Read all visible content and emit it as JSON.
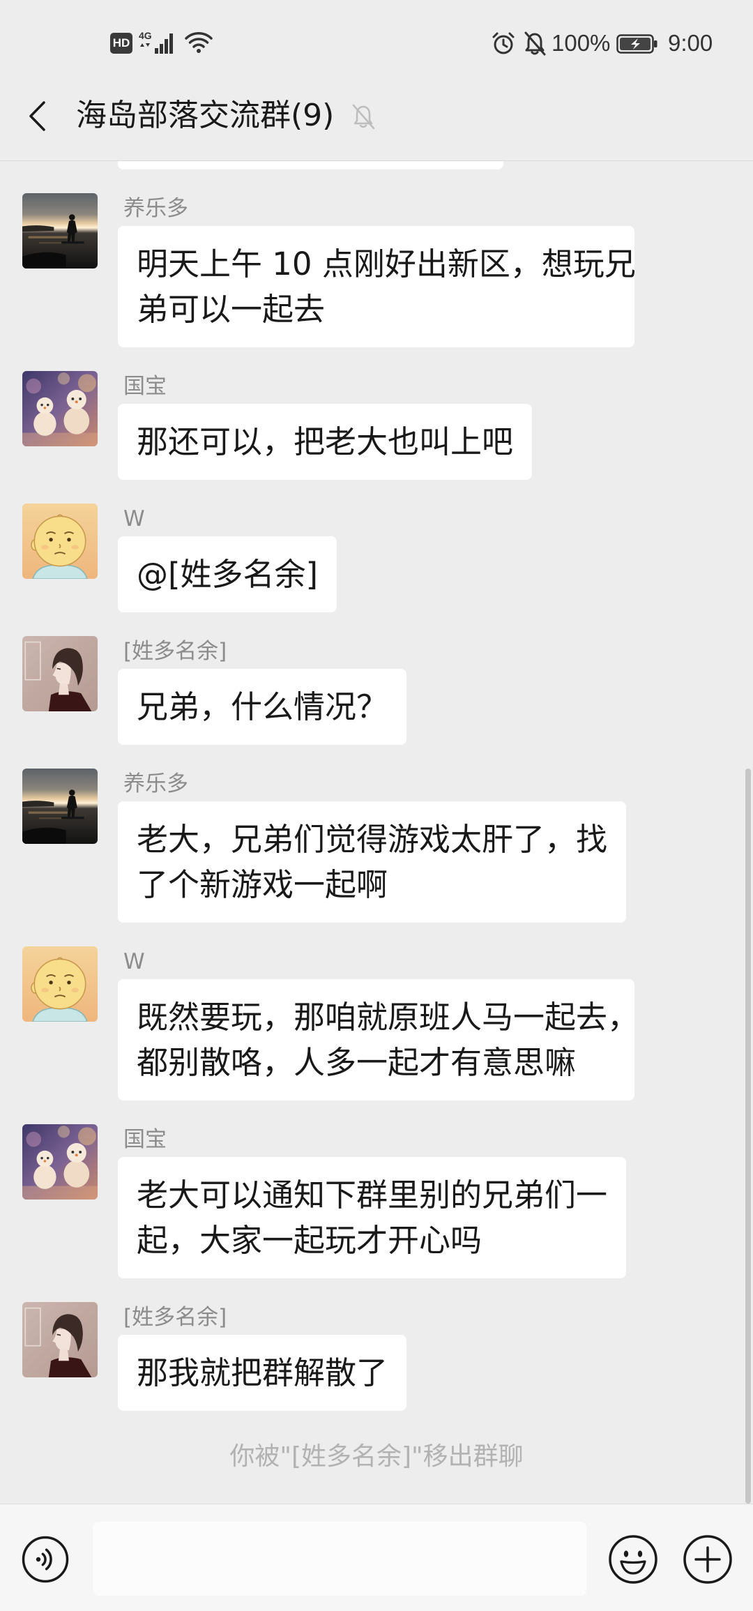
{
  "status_bar": {
    "hd_label": "HD",
    "network_label": "4G",
    "battery_percent": "100%",
    "battery_level": 1,
    "time": "9:00",
    "icons": {
      "hd": "hd-badge-icon",
      "signal": "cellular-signal-icon",
      "wifi": "wifi-icon",
      "alarm": "alarm-clock-icon",
      "silent": "bell-off-icon",
      "battery": "battery-charging-icon"
    }
  },
  "header": {
    "title": "海岛部落交流群(9)",
    "back_icon": "chevron-left-icon",
    "mute_icon": "bell-off-icon"
  },
  "messages": [
    {
      "sender": "养乐多",
      "avatar_icon": "sunset-silhouette-avatar",
      "lines": [
        "明天上午 10 点刚好出新区，想玩兄",
        "弟可以一起去"
      ]
    },
    {
      "sender": "国宝",
      "avatar_icon": "snowman-avatar",
      "lines": [
        "那还可以，把老大也叫上吧"
      ]
    },
    {
      "sender": "W",
      "avatar_icon": "cartoon-baby-avatar",
      "lines": [
        "@[姓多名余]"
      ]
    },
    {
      "sender": "[姓多名余]",
      "avatar_icon": "anime-profile-avatar",
      "lines": [
        "兄弟，什么情况？"
      ]
    },
    {
      "sender": "养乐多",
      "avatar_icon": "sunset-silhouette-avatar",
      "lines": [
        "老大，兄弟们觉得游戏太肝了，找",
        "了个新游戏一起啊"
      ]
    },
    {
      "sender": "W",
      "avatar_icon": "cartoon-baby-avatar",
      "lines": [
        "既然要玩，那咱就原班人马一起去，",
        "都别散咯，人多一起才有意思嘛"
      ]
    },
    {
      "sender": "国宝",
      "avatar_icon": "snowman-avatar",
      "lines": [
        "老大可以通知下群里别的兄弟们一",
        "起，大家一起玩才开心吗"
      ]
    },
    {
      "sender": "[姓多名余]",
      "avatar_icon": "anime-profile-avatar",
      "lines": [
        "那我就把群解散了"
      ]
    }
  ],
  "system_message": "你被\"[姓多名余]\"移出群聊",
  "input_bar": {
    "text": "",
    "voice_icon": "voice-input-icon",
    "emoji_icon": "emoji-icon",
    "more_icon": "plus-circle-icon"
  },
  "colors": {
    "background": "#ededed",
    "bubble": "#ffffff",
    "text": "#191919",
    "sender_name": "#8c8c8c",
    "system_text": "#b2b2b2",
    "input_bar": "#f6f6f6"
  }
}
